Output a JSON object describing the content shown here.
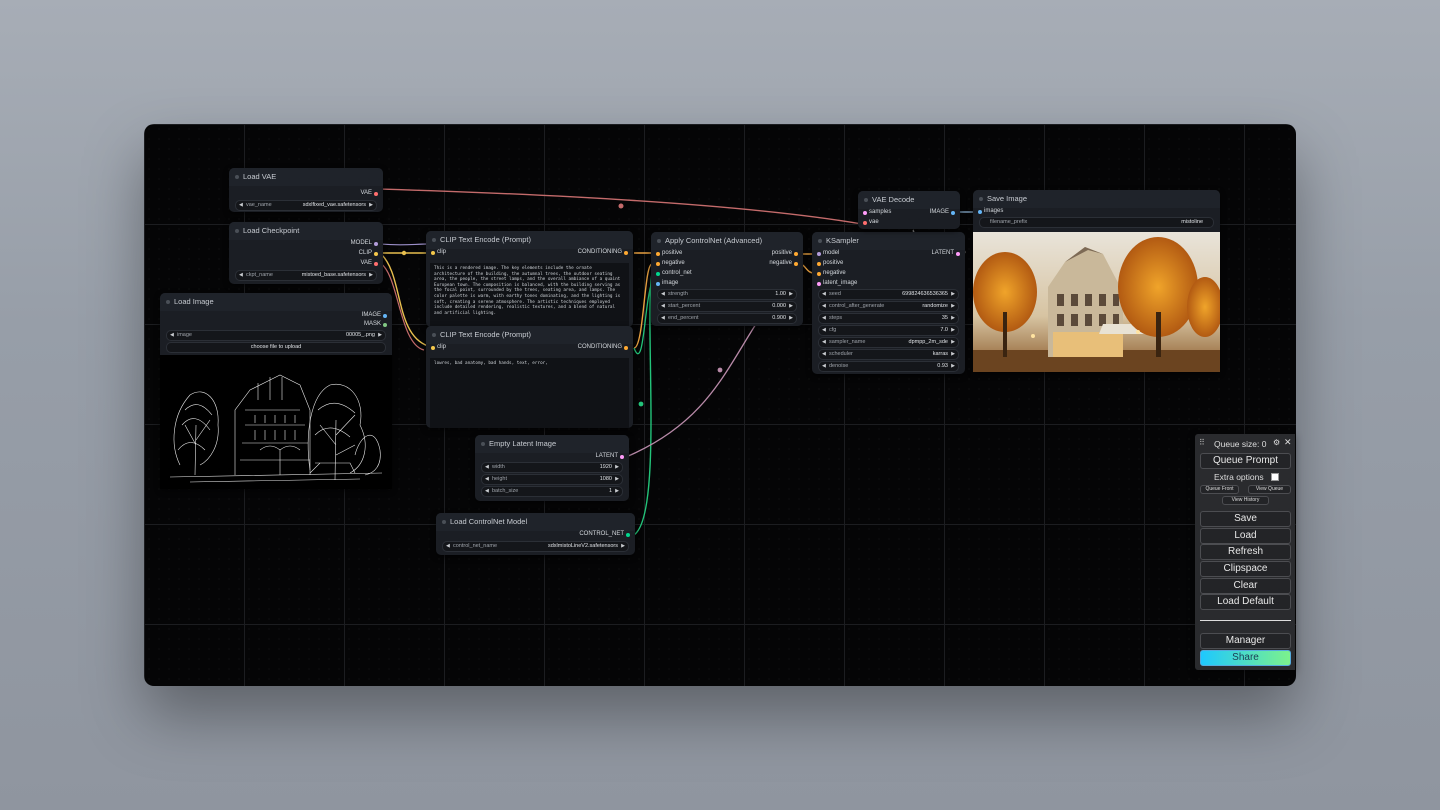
{
  "nodes": {
    "load_vae": {
      "title": "Load VAE",
      "out_vae": "VAE",
      "widget_label": "vae_name",
      "widget_value": "sdxlfixed_vae.safetensors"
    },
    "load_checkpoint": {
      "title": "Load Checkpoint",
      "out_model": "MODEL",
      "out_clip": "CLIP",
      "out_vae": "VAE",
      "widget_label": "ckpt_name",
      "widget_value": "mistoed_base.safetensors"
    },
    "load_image": {
      "title": "Load Image",
      "out_image": "IMAGE",
      "out_mask": "MASK",
      "widget_label": "image",
      "widget_value": "00005_.png",
      "upload_label": "choose file to upload"
    },
    "clip_pos": {
      "title": "CLIP Text Encode (Prompt)",
      "in_clip": "clip",
      "out": "CONDITIONING",
      "text": "This is a rendered image. The key elements include the ornate architecture of the building, the autumnal trees, the outdoor seating area, the people, the street lamps, and the overall ambiance of a quaint European town. The composition is balanced, with the building serving as the focal point, surrounded by the trees, seating area, and lamps. The color palette is warm, with earthy tones dominating, and the lighting is soft, creating a serene atmosphere. The artistic techniques employed include detailed rendering, realistic textures, and a blend of natural and artificial lighting."
    },
    "clip_neg": {
      "title": "CLIP Text Encode (Prompt)",
      "in_clip": "clip",
      "out": "CONDITIONING",
      "text": "lowres, bad anatomy, bad hands, text, error,"
    },
    "apply_controlnet": {
      "title": "Apply ControlNet (Advanced)",
      "in_positive": "positive",
      "in_negative": "negative",
      "in_control_net": "control_net",
      "in_image": "image",
      "out_positive": "positive",
      "out_negative": "negative",
      "widgets": [
        {
          "label": "strength",
          "value": "1.00"
        },
        {
          "label": "start_percent",
          "value": "0.000"
        },
        {
          "label": "end_percent",
          "value": "0.900"
        }
      ]
    },
    "ksampler": {
      "title": "KSampler",
      "in_model": "model",
      "in_positive": "positive",
      "in_negative": "negative",
      "in_latent": "latent_image",
      "out": "LATENT",
      "widgets": [
        {
          "label": "seed",
          "value": "699824636536365"
        },
        {
          "label": "control_after_generate",
          "value": "randomize"
        },
        {
          "label": "steps",
          "value": "35"
        },
        {
          "label": "cfg",
          "value": "7.0"
        },
        {
          "label": "sampler_name",
          "value": "dpmpp_2m_sde"
        },
        {
          "label": "scheduler",
          "value": "karras"
        },
        {
          "label": "denoise",
          "value": "0.93"
        }
      ]
    },
    "vae_decode": {
      "title": "VAE Decode",
      "in_samples": "samples",
      "in_vae": "vae",
      "out": "IMAGE"
    },
    "save_image": {
      "title": "Save Image",
      "in_images": "images",
      "widget_label": "filename_prefix",
      "widget_value": "mistoline"
    },
    "empty_latent": {
      "title": "Empty Latent Image",
      "out": "LATENT",
      "widgets": [
        {
          "label": "width",
          "value": "1920"
        },
        {
          "label": "height",
          "value": "1080"
        },
        {
          "label": "batch_size",
          "value": "1"
        }
      ]
    },
    "load_controlnet": {
      "title": "Load ControlNet Model",
      "out": "CONTROL_NET",
      "widget_label": "control_net_name",
      "widget_value": "sdxlmistoLineV2.safetensors"
    }
  },
  "menu": {
    "queue_size": "Queue size: 0",
    "queue_prompt": "Queue Prompt",
    "extra_options": "Extra options",
    "queue_front": "Queue Front",
    "view_queue": "View Queue",
    "view_history": "View History",
    "save": "Save",
    "load": "Load",
    "refresh": "Refresh",
    "clipspace": "Clipspace",
    "clear": "Clear",
    "load_default": "Load Default",
    "manager": "Manager",
    "share": "Share"
  },
  "colors": {
    "model": "#b39ddb",
    "clip": "#f5c84b",
    "vae": "#ff6e6e",
    "conditioning": "#ffa931",
    "image": "#64b5f6",
    "latent": "#ff9cf9",
    "control_net": "#00d78d",
    "mask": "#81c784"
  }
}
